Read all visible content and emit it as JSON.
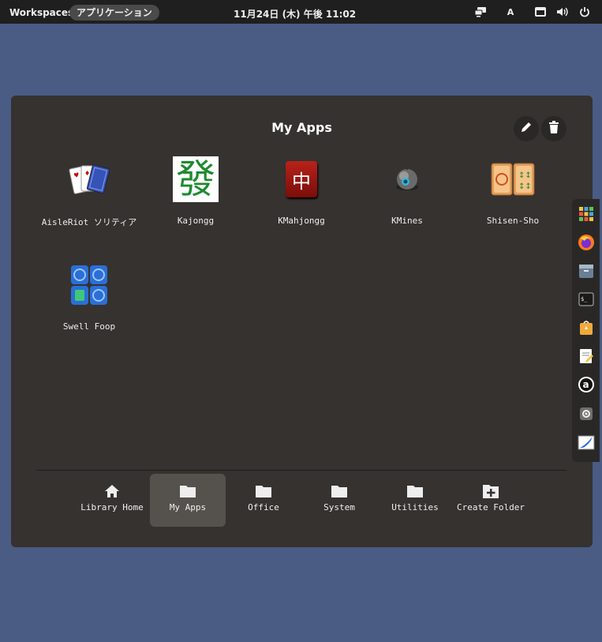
{
  "topbar": {
    "workspaces": "Workspaces",
    "applications": "アプリケーション",
    "clock": "11月24日 (木) 午後 11:02",
    "keyboard_layout": "A"
  },
  "launcher": {
    "title": "My Apps",
    "apps": [
      {
        "label": "AisleRiot ソリティア",
        "icon": "cards-icon"
      },
      {
        "label": "Kajongg",
        "icon": "kajongg-icon"
      },
      {
        "label": "KMahjongg",
        "icon": "kmahjongg-icon"
      },
      {
        "label": "KMines",
        "icon": "kmines-icon"
      },
      {
        "label": "Shisen-Sho",
        "icon": "shisen-sho-icon"
      },
      {
        "label": "Swell Foop",
        "icon": "swell-foop-icon"
      }
    ],
    "categories": [
      {
        "label": "Library Home",
        "icon": "home-icon",
        "active": false
      },
      {
        "label": "My Apps",
        "icon": "folder-icon",
        "active": true
      },
      {
        "label": "Office",
        "icon": "folder-icon",
        "active": false
      },
      {
        "label": "System",
        "icon": "folder-icon",
        "active": false
      },
      {
        "label": "Utilities",
        "icon": "folder-icon",
        "active": false
      },
      {
        "label": "Create Folder",
        "icon": "folder-add-icon",
        "active": false
      }
    ]
  },
  "kajongg_glyph": "發",
  "kmahjongg_glyph": "中",
  "dock": [
    "app-grid-icon",
    "firefox-icon",
    "files-icon",
    "terminal-icon",
    "software-icon",
    "text-editor-icon",
    "a-icon",
    "settings-icon",
    "scribus-icon"
  ]
}
